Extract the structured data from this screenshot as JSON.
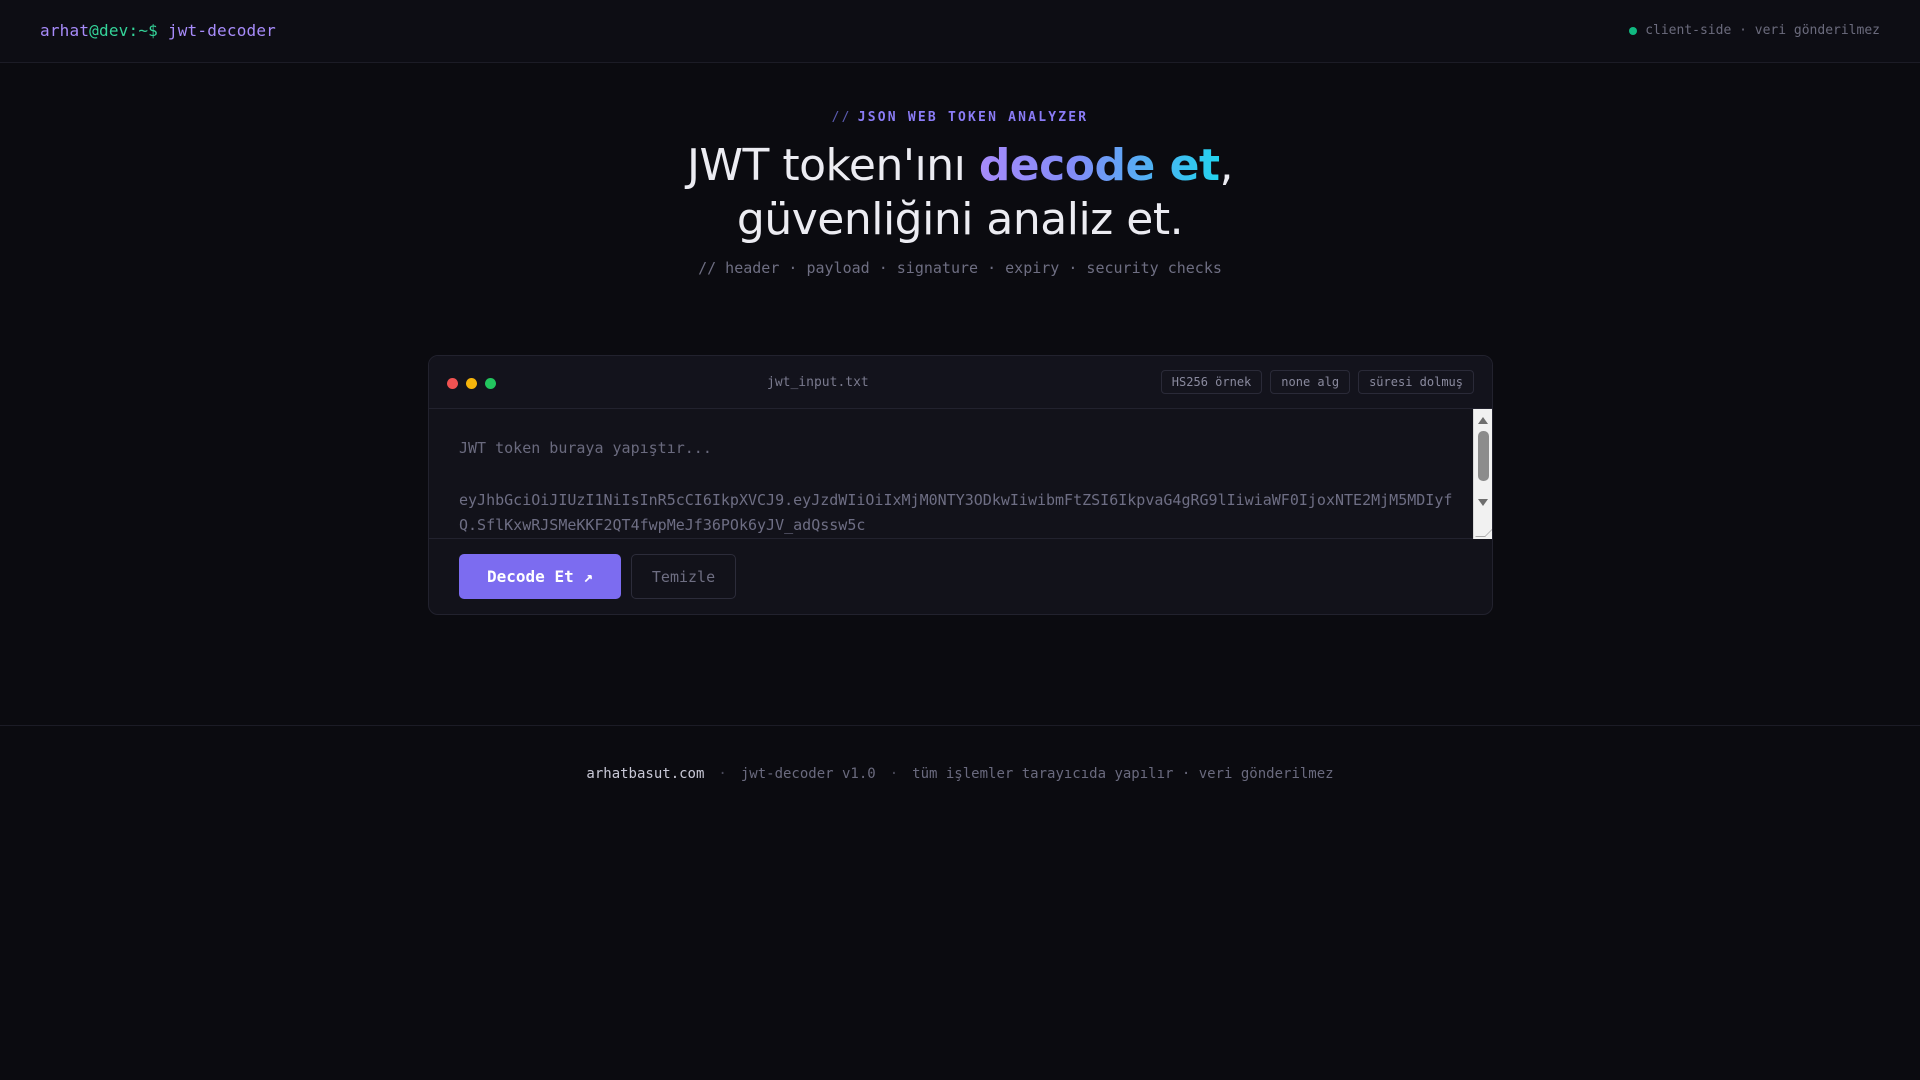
{
  "topbar": {
    "prompt_user": "arhat",
    "prompt_at": "@dev:~$",
    "prompt_cmd": "jwt-decoder",
    "status_text": "client-side · veri gönderilmez",
    "status_color": "#10b981"
  },
  "hero": {
    "eyebrow_slashes": "//",
    "eyebrow": "JSON WEB TOKEN ANALYZER",
    "headline_part1": "JWT token'ını ",
    "headline_highlight": "decode et",
    "headline_part2": ",",
    "headline_line2": "güvenliğini analiz et.",
    "subline": "// header · payload · signature · expiry · security checks"
  },
  "editor": {
    "filename": "jwt_input.txt",
    "chips": [
      "HS256 örnek",
      "none alg",
      "süresi dolmuş"
    ],
    "placeholder": "JWT token buraya yapıştır...",
    "token": "eyJhbGciOiJIUzI1NiIsInR5cCI6IkpXVCJ9.eyJzdWIiOiIxMjM0NTY3ODkwIiwibmFtZSI6IkpvaG4gRG9lIiwiaWF0IjoxNTE2MjM5MDIyfQ.SflKxwRJSMeKKF2QT4fwpMeJf36POk6yJV_adQssw5c",
    "decode_label": "Decode Et ↗",
    "clear_label": "Temizle"
  },
  "footer": {
    "site": "arhatbasut.com",
    "sep": "·",
    "version": "jwt-decoder v1.0",
    "note": "tüm işlemler tarayıcıda yapılır · veri gönderilmez"
  }
}
